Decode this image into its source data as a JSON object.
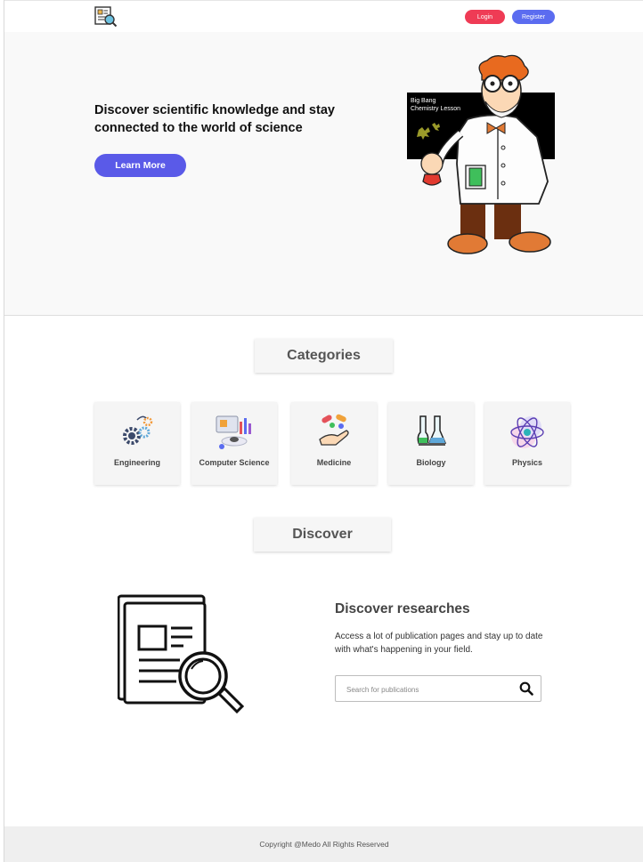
{
  "header": {
    "logo_icon": "research-logo-icon",
    "login_label": "Login",
    "register_label": "Register"
  },
  "hero": {
    "title": "Discover scientific knowledge and stay connected to the world of science",
    "cta_label": "Learn More",
    "illustration_icon": "scientist-illustration",
    "board_text": "Big Bang Chemistry Lesson"
  },
  "categories": {
    "title": "Categories",
    "items": [
      {
        "label": "Engineering",
        "icon": "gears-icon"
      },
      {
        "label": "Computer Science",
        "icon": "computer-icon"
      },
      {
        "label": "Medicine",
        "icon": "pills-icon"
      },
      {
        "label": "Biology",
        "icon": "flasks-icon"
      },
      {
        "label": "Physics",
        "icon": "atom-icon"
      }
    ]
  },
  "discover": {
    "title": "Discover",
    "heading": "Discover researches",
    "text": "Access a lot of publication pages and stay up to date with what's happening in your field.",
    "search_placeholder": "Search for publications",
    "search_icon": "search-icon"
  },
  "footer": {
    "copyright": "Copyright @Medo All Rights Reserved"
  },
  "colors": {
    "login": "#ef3b55",
    "register": "#5b6cf0",
    "accent": "#5a5ae8"
  }
}
